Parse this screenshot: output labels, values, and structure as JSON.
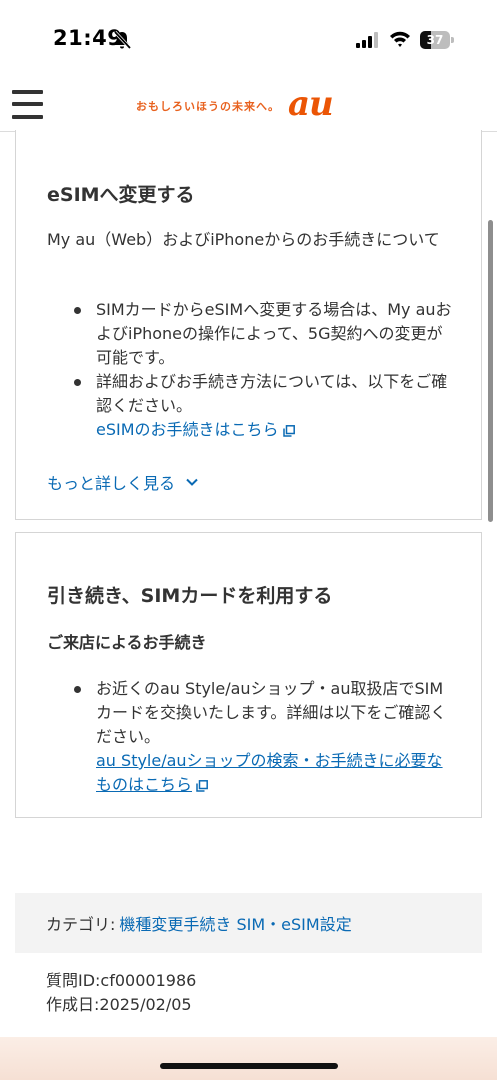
{
  "status_bar": {
    "time": "21:49",
    "battery_level": "37",
    "battery_fraction": 0.37,
    "icons": [
      "bell-slash-icon",
      "signal-icon",
      "wifi-icon",
      "battery-icon"
    ]
  },
  "header": {
    "menu_icon": "hamburger-menu-icon",
    "tagline": "おもしろいほうの未来へ。",
    "logo": "au",
    "brand_color": "#eb5505"
  },
  "card1": {
    "title": "eSIMへ変更する",
    "intro": "My au（Web）およびiPhoneからのお手続きについて",
    "bullets": [
      "SIMカードからeSIMへ変更する場合は、My auおよびiPhoneの操作によって、5G契約への変更が可能です。",
      "詳細およびお手続き方法については、以下をご確認ください。"
    ],
    "link": "eSIMのお手続きはこちら",
    "more": "もっと詳しく見る"
  },
  "card2": {
    "title": "引き続き、SIMカードを利用する",
    "subheading": "ご来店によるお手続き",
    "bullet": "お近くのau Style/auショップ・au取扱店でSIMカードを交換いたします。詳細は以下をご確認ください。",
    "link": "au Style/auショップの検索・お手続きに必要なものはこちら"
  },
  "footer": {
    "category_label": "カテゴリ:",
    "category_link": "機種変更手続き SIM・eSIM設定",
    "question_id": "質問ID:cf00001986",
    "created": "作成日:2025/02/05"
  },
  "colors": {
    "link": "#0a6ab4",
    "accent": "#eb5505",
    "text": "#333333"
  }
}
